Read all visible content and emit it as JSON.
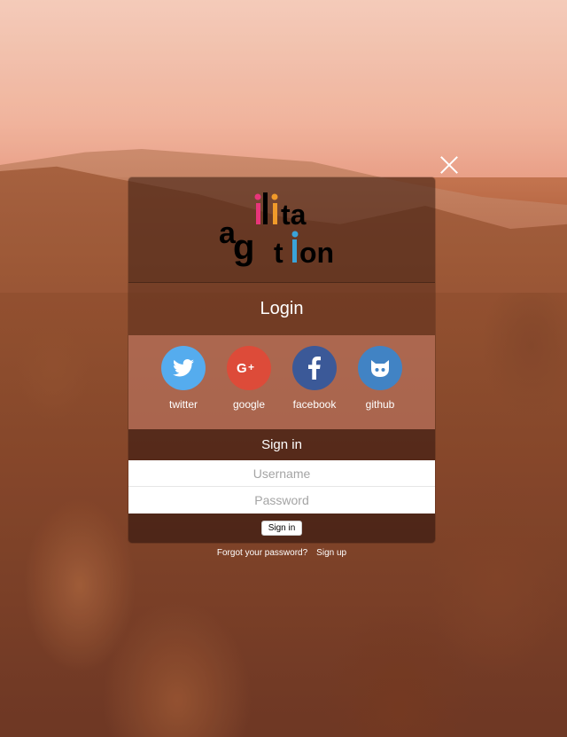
{
  "logo": {
    "letters": [
      "a",
      "g",
      "l",
      "i",
      "t",
      "a",
      "t",
      "i",
      "o",
      "n"
    ]
  },
  "close": {
    "icon": "close-icon"
  },
  "login": {
    "title": "Login"
  },
  "social": [
    {
      "label": "twitter",
      "icon": "twitter-icon",
      "color": "#55acee"
    },
    {
      "label": "google",
      "icon": "google-plus-icon",
      "color": "#dd4b39"
    },
    {
      "label": "facebook",
      "icon": "facebook-icon",
      "color": "#3b5998"
    },
    {
      "label": "github",
      "icon": "github-icon",
      "color": "#4183c4"
    }
  ],
  "signin": {
    "heading": "Sign in",
    "username_placeholder": "Username",
    "password_placeholder": "Password",
    "button_label": "Sign in"
  },
  "links": {
    "forgot": "Forgot your password?",
    "signup": "Sign up"
  }
}
